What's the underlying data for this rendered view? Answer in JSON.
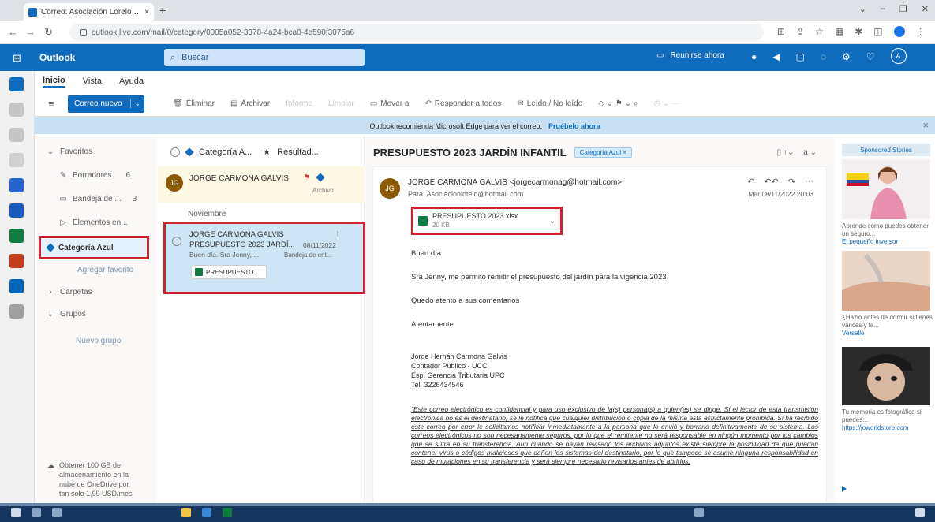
{
  "browser": {
    "tab_title": "Correo: Asociación Lorelo Apaj...",
    "tab_close": "×",
    "new_tab": "+",
    "window_controls": [
      "⌄",
      "–",
      "❐",
      "✕"
    ],
    "url": "outlook.live.com/mail/0/category/0005a052-3378-4a24-bca0-4e590f3075a6"
  },
  "outlook": {
    "brand": "Outlook",
    "search_placeholder": "Buscar",
    "try_label": "Reunirse ahora"
  },
  "ribbon": {
    "tabs": [
      "Inicio",
      "Vista",
      "Ayuda"
    ],
    "new_mail": "Correo nuevo",
    "commands": [
      "Eliminar",
      "Archivar",
      "Informe",
      "Limpiar",
      "Mover a",
      "Responder a todos",
      "Leído / No leído"
    ]
  },
  "banner": {
    "text": "Outlook recomienda Microsoft Edge para ver el correo.",
    "link": "Pruébelo ahora"
  },
  "folders": {
    "favorites": "Favoritos",
    "items": [
      {
        "label": "Borradores",
        "count": "6"
      },
      {
        "label": "Bandeja de ...",
        "count": "3"
      },
      {
        "label": "Elementos en...",
        "count": ""
      }
    ],
    "selected": "Categoría Azul",
    "add_favorite": "Agregar favorito",
    "folders_group": "Carpetas",
    "groups": "Grupos",
    "new_group": "Nuevo grupo",
    "onedrive": "Obtener 100 GB de almacenamiento en la nube de OneDrive por tan solo 1,99 USD/mes"
  },
  "message_list": {
    "header_category": "Categoría A...",
    "header_results": "Resultad...",
    "pinned": {
      "initials": "JG",
      "from": "JORGE CARMONA GALVIS",
      "archive_label": "Archivo"
    },
    "group_label": "Noviembre",
    "selected": {
      "from": "JORGE CARMONA GALVIS",
      "subject": "PRESUPUESTO 2023 JARDÍ...",
      "date": "08/11/2022",
      "preview": "Buen día. Sra Jenny, ...",
      "folder": "Bandeja de ent...",
      "attachment": "PRESUPUESTO..."
    }
  },
  "reading": {
    "subject": "PRESUPUESTO 2023 JARDÍN INFANTIL",
    "category_tag": "Categoría Azul",
    "sender": "JORGE CARMONA GALVIS <jorgecarmonag@hotmail.com>",
    "to": "Para: Asociacionlotelo@hotmail.com",
    "date": "Mar 08/11/2022 20:03",
    "attachment_name": "PRESUPUESTO 2023.xlsx",
    "attachment_size": "20 KB",
    "greeting": "Buen día",
    "line1": "Sra Jenny, me permito remitir el presupuesto del jardín para la vigencia 2023",
    "line2": "Quedo atento a sus comentarios",
    "closing": "Atentamente",
    "signature": [
      "Jorge Hernán Carmona Galvis",
      "Contador Publico - UCC",
      "Esp. Gerencia Tributaria UPC",
      "Tel. 3226434546"
    ],
    "legal": "\"Este correo electrónico es confidencial y para uso exclusivo de la(s) persona(s) a quien(es) se dirige. Si el lector de esta transmisión electrónica no es el destinatario, se le notifica que cualquier distribución o copia de la misma está estrictamente prohibida. Si ha recibido este correo por error le solicitamos notificar inmediatamente a la persona que lo envió y borrarlo definitivamente de su sistema. Los correos electrónicos no son necesariamente seguros, por lo que el remitente no será responsable en ningún momento por los cambios que se sufra en su transferencia. Aún cuando se hayan revisado los archivos adjuntos existe siempre la posibilidad de que puedan contener virus o códigos maliciosos que dañen los sistemas del destinatario, por lo que tampoco se asume ninguna responsabilidad en caso de mutaciones en su transferencia y será siempre necesario revisarlos antes de abrirlos."
  },
  "ads": {
    "label": "Sponsored Stories",
    "items": [
      {
        "text": "Aprende cómo puedes obtener un seguro...",
        "source": "El pequeño inversor"
      },
      {
        "text": "¿Hazlo antes de dormir si tienes varices y la...",
        "source": "Versalle"
      },
      {
        "text": "Tu memoria es fotográfica si puedes...",
        "source": "https://joworldstore.com"
      }
    ]
  },
  "colors": {
    "outlook_blue": "#0f6cbd",
    "highlight_red": "#d0232f",
    "selected_bg": "#cde6f7"
  }
}
